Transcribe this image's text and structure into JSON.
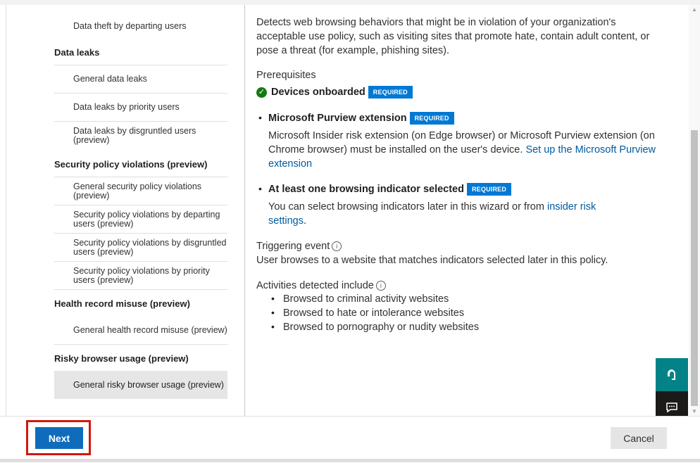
{
  "nav": {
    "items": [
      {
        "type": "item",
        "label": "Data theft by departing users"
      },
      {
        "type": "category",
        "label": "Data leaks"
      },
      {
        "type": "item",
        "label": "General data leaks"
      },
      {
        "type": "item",
        "label": "Data leaks by priority users"
      },
      {
        "type": "item",
        "label": "Data leaks by disgruntled users (preview)"
      },
      {
        "type": "category",
        "label": "Security policy violations (preview)"
      },
      {
        "type": "item",
        "label": "General security policy violations (preview)"
      },
      {
        "type": "item",
        "label": "Security policy violations by departing users (preview)"
      },
      {
        "type": "item",
        "label": "Security policy violations by disgruntled users (preview)"
      },
      {
        "type": "item",
        "label": "Security policy violations by priority users (preview)"
      },
      {
        "type": "category",
        "label": "Health record misuse (preview)"
      },
      {
        "type": "item",
        "label": "General health record misuse (preview)"
      },
      {
        "type": "category",
        "label": "Risky browser usage (preview)"
      },
      {
        "type": "item",
        "label": "General risky browser usage (preview)",
        "selected": true
      }
    ]
  },
  "main": {
    "description": "Detects web browsing behaviors that might be in violation of your organization's acceptable use policy, such as visiting sites that promote hate, contain adult content, or pose a threat (for example, phishing sites).",
    "prerequisites_heading": "Prerequisites",
    "devices_onboarded": "Devices onboarded",
    "required_badge": "REQUIRED",
    "purview_extension": {
      "title": "Microsoft Purview extension",
      "body": "Microsoft Insider risk extension (on Edge browser) or Microsoft Purview extension (on Chrome browser) must be installed on the user's device.",
      "link": "Set up the Microsoft Purview extension"
    },
    "browsing_indicator": {
      "title": "At least one browsing indicator selected",
      "body": "You can select browsing indicators later in this wizard or from",
      "link": "insider risk settings",
      "end": "."
    },
    "triggering_event": {
      "title": "Triggering event",
      "body": "User browses to a website that matches indicators selected later in this policy."
    },
    "activities": {
      "title": "Activities detected include",
      "items": [
        "Browsed to criminal activity websites",
        "Browsed to hate or intolerance websites",
        "Browsed to pornography or nudity websites"
      ]
    }
  },
  "footer": {
    "next_label": "Next",
    "cancel_label": "Cancel"
  },
  "icons": {
    "help": "headset-help-icon",
    "feedback": "feedback-icon",
    "check": "check-circle-icon",
    "info": "info-icon"
  },
  "colors": {
    "accent": "#0f6cbd",
    "badge": "#0078d4",
    "success": "#107c10",
    "highlight_outline": "#d2180f",
    "teal": "#038387"
  }
}
